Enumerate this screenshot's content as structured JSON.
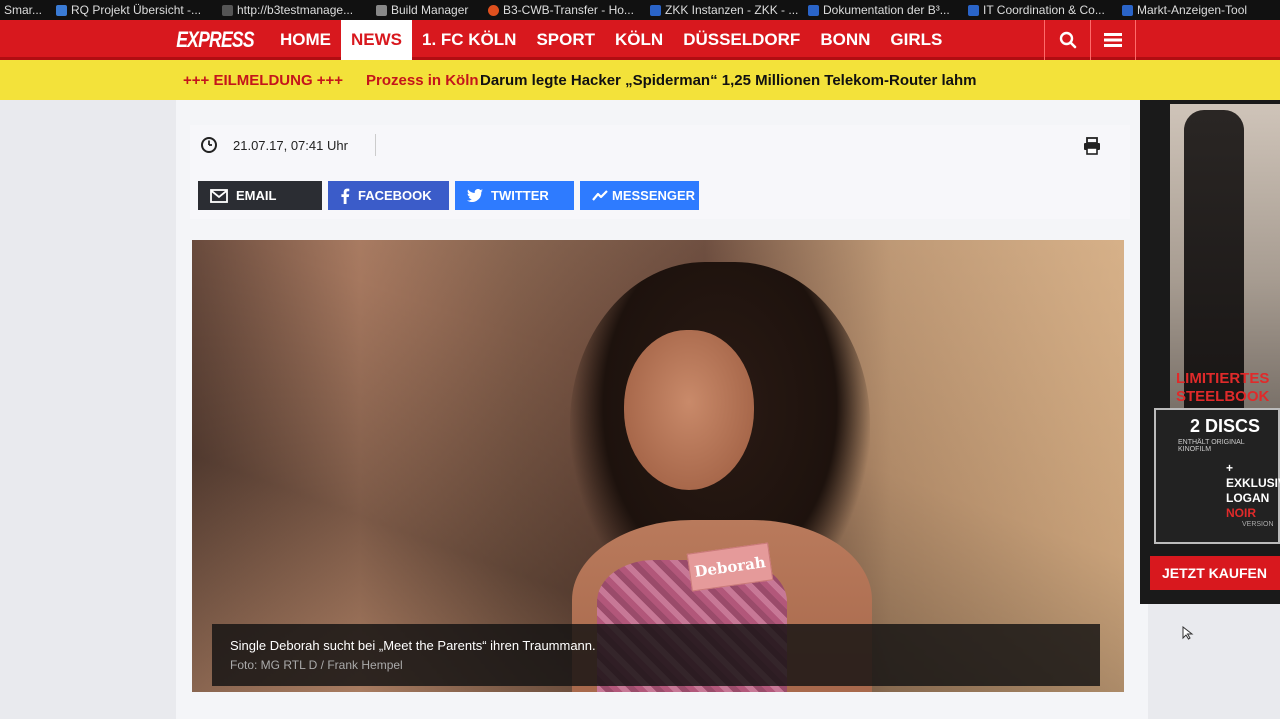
{
  "bookmarks": [
    {
      "label": "Smar...",
      "color": "#555555"
    },
    {
      "label": "RQ Projekt Übersicht -...",
      "color": "#3a7bd5"
    },
    {
      "label": "http://b3testmanage...",
      "color": "#555555"
    },
    {
      "label": "Build Manager",
      "color": "#888888"
    },
    {
      "label": "B3-CWB-Transfer - Ho...",
      "color": "#e0501e"
    },
    {
      "label": "ZKK Instanzen - ZKK - ...",
      "color": "#2a64c8"
    },
    {
      "label": "Dokumentation der B³...",
      "color": "#2a64c8"
    },
    {
      "label": "IT Coordination & Co...",
      "color": "#2a64c8"
    },
    {
      "label": "Markt-Anzeigen-Tool",
      "color": "#2a64c8"
    }
  ],
  "nav": {
    "logo": "EXPRESS",
    "items": [
      "HOME",
      "NEWS",
      "1. FC KÖLN",
      "SPORT",
      "KÖLN",
      "DÜSSELDORF",
      "BONN",
      "GIRLS"
    ],
    "active_index": 1,
    "search_icon": "search-icon",
    "menu_icon": "menu-icon"
  },
  "breaking": {
    "tag": "+++ EILMELDUNG +++",
    "location": "Prozess in Köln",
    "headline": "Darum legte Hacker „Spiderman“ 1,25 Millionen Telekom-Router lahm"
  },
  "article": {
    "date": "21.07.17, 07:41 Uhr",
    "share": [
      {
        "label": "EMAIL",
        "icon": "email-icon",
        "color": "#2b2d33"
      },
      {
        "label": "FACEBOOK",
        "icon": "facebook-icon",
        "color": "#3b5cc9"
      },
      {
        "label": "TWITTER",
        "icon": "twitter-icon",
        "color": "#2e7bff"
      },
      {
        "label": "MESSENGER",
        "icon": "messenger-icon",
        "color": "#2e7bff"
      }
    ],
    "image": {
      "nametag": "Deborah",
      "caption": "Single Deborah sucht bei „Meet the Parents“ ihren Traummann.",
      "credit": "Foto: MG RTL D / Frank Hempel"
    }
  },
  "ad": {
    "headline1": "LIMITIERTES",
    "headline2": "STEELBOOK",
    "discs": "2 DISCS",
    "discs_sub": "ENTHÄLT ORIGINAL KINOFILM",
    "exclusive": "+ EXKLUSIV",
    "title": "LOGAN",
    "title_suffix": "NOIR",
    "version": "VERSION",
    "cta": "JETZT KAUFEN"
  },
  "colors": {
    "brand_red": "#d8181e",
    "breaking_yellow": "#f3e23a"
  }
}
